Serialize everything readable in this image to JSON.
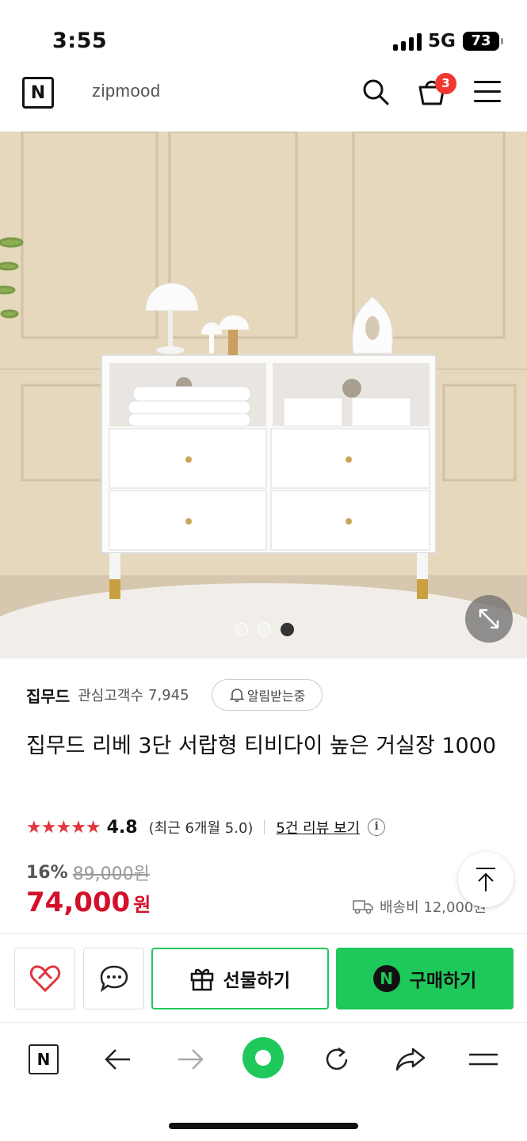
{
  "status_bar": {
    "time": "3:55",
    "network": "5G",
    "battery": "73"
  },
  "header": {
    "brand_logo": "zipmood",
    "cart_count": "3",
    "icons": [
      "naver-n-icon",
      "search-icon",
      "cart-icon",
      "menu-icon"
    ]
  },
  "gallery": {
    "total_images": 3,
    "active_index": 3
  },
  "store": {
    "name": "집무드",
    "followers_label": "관심고객수",
    "followers_count": "7,945",
    "notify_label": "알림받는중"
  },
  "product": {
    "title": "집무드 리베 3단 서랍형 티비다이 높은 거실장 1000",
    "stars": "★★★★★",
    "rating": "4.8",
    "recent_rating": "(최근 6개월 5.0)",
    "review_link": "5건 리뷰 보기",
    "info": "i"
  },
  "price": {
    "discount": "16%",
    "original": "89,000원",
    "sale": "74,000",
    "unit": "원",
    "shipping": "배송비 12,000원"
  },
  "actions": {
    "gift_label": "선물하기",
    "buy_label": "구매하기",
    "buy_icon": "N"
  },
  "browser_nav": {
    "icons": [
      "naver-home-icon",
      "back-arrow-icon",
      "forward-arrow-icon",
      "green-dot-icon",
      "refresh-icon",
      "share-icon",
      "menu-icon"
    ]
  },
  "colors": {
    "accent_green": "#1ec85a",
    "sale_red": "#d3102a",
    "star_red": "#e0353f",
    "badge_red": "#f0362f"
  }
}
